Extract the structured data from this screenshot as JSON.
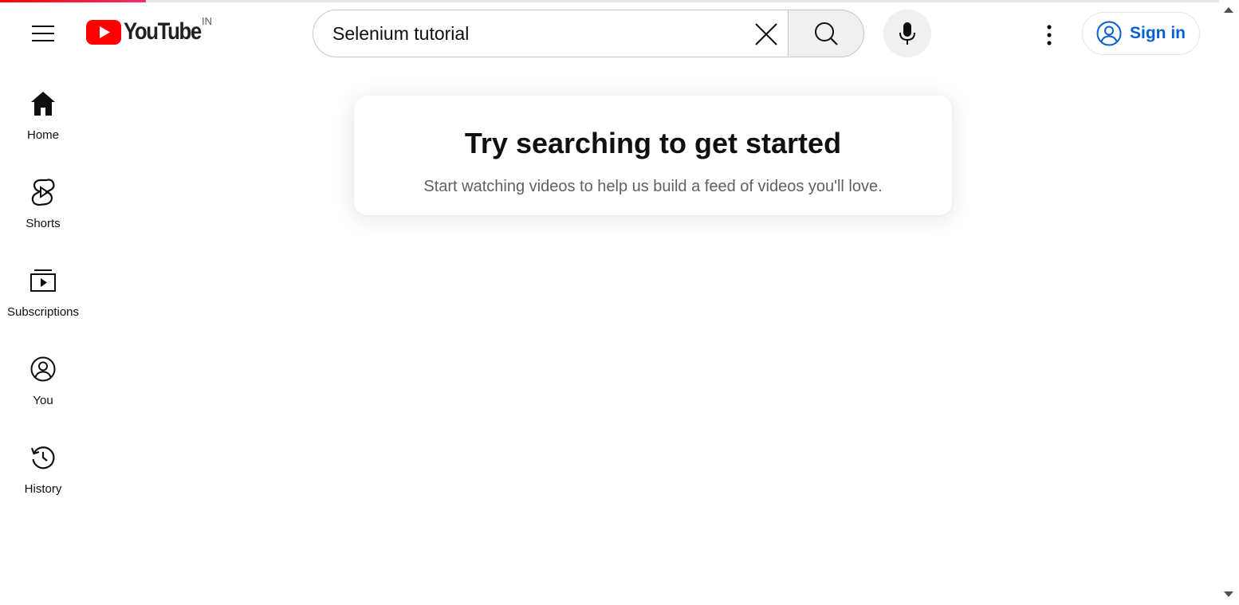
{
  "app": {
    "country_code": "IN",
    "logo_text": "YouTube"
  },
  "colors": {
    "brand_red": "#ff0000",
    "link_blue": "#065fd4",
    "muted_text": "#606060"
  },
  "page_load": {
    "progress_fraction": 0.12
  },
  "search": {
    "value": "Selenium tutorial",
    "placeholder": "Search"
  },
  "header": {
    "signin_label": "Sign in"
  },
  "sidebar": {
    "items": [
      {
        "label": "Home",
        "icon": "home-icon"
      },
      {
        "label": "Shorts",
        "icon": "shorts-icon"
      },
      {
        "label": "Subscriptions",
        "icon": "subscriptions-icon"
      },
      {
        "label": "You",
        "icon": "you-icon"
      },
      {
        "label": "History",
        "icon": "history-icon"
      }
    ]
  },
  "main": {
    "prompt_title": "Try searching to get started",
    "prompt_subtitle": "Start watching videos to help us build a feed of videos you'll love."
  }
}
